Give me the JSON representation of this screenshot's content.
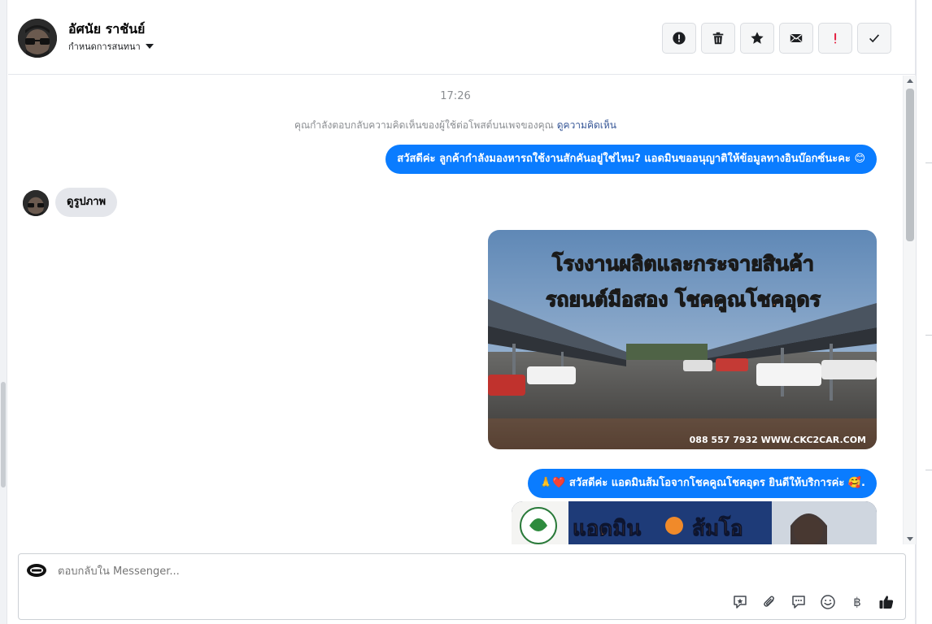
{
  "header": {
    "contact_name": "อัศนัย ราชันย์",
    "status_label": "กำหนดการสนทนา",
    "actions": [
      {
        "name": "alert-button",
        "icon": "exclamation-circle-icon"
      },
      {
        "name": "delete-button",
        "icon": "trash-icon"
      },
      {
        "name": "star-button",
        "icon": "star-icon"
      },
      {
        "name": "mark-unread-button",
        "icon": "envelope-icon"
      },
      {
        "name": "flag-important-button",
        "icon": "exclamation-icon"
      },
      {
        "name": "mark-done-button",
        "icon": "check-icon"
      }
    ]
  },
  "thread": {
    "timestamp": "17:26",
    "notice_text": "คุณกำลังตอบกลับความคิดเห็นของผู้ใช้ต่อโพสต์บนเพจของคุณ",
    "notice_link": "ดูความคิดเห็น",
    "messages": [
      {
        "direction": "out",
        "text": "สวัสดีค่ะ ลูกค้ากำลังมองหารถใช้งานสักคันอยู่ใช่ไหม? แอดมินขออนุญาติให้ข้อมูลทางอินบ๊อกซ์นะคะ 😊"
      },
      {
        "direction": "in",
        "text": "ดูรูปภาพ"
      },
      {
        "direction": "out",
        "type": "image",
        "headline_1": "โรงงานผลิตและกระจายสินค้า",
        "headline_2": "รถยนต์มือสอง โชคคูณโชคอุดร",
        "footer": "088 557 7932 WWW.CKC2CAR.COM"
      },
      {
        "direction": "out",
        "text": "🙏❤️ สวัสดีค่ะ แอดมินส้มโอจากโชคคูณโชคอุดร ยินดีให้บริการค่ะ 🥰."
      },
      {
        "direction": "out",
        "type": "image",
        "headline": "แอดมิน",
        "headline_2": "ส้มโอ"
      }
    ]
  },
  "composer": {
    "placeholder": "ตอบกลับใน Messenger...",
    "tools": [
      "saved-reply-icon",
      "paperclip-icon",
      "chat-bubble-icon",
      "emoji-icon",
      "baht-icon",
      "thumbs-up-icon"
    ],
    "currency_symbol": "฿"
  },
  "colors": {
    "accent": "#0a7cff",
    "incoming_bubble": "#e4e6eb",
    "flag_red": "#e41e3f"
  }
}
